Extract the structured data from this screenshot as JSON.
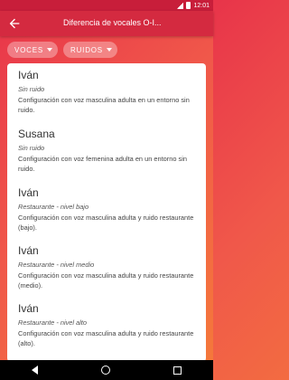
{
  "status_bar": {
    "time": "12:01"
  },
  "app_bar": {
    "title": "Diferencia de vocales O-I..."
  },
  "filters": [
    {
      "label": "VOCES"
    },
    {
      "label": "RUIDOS"
    }
  ],
  "items": [
    {
      "name": "Iván",
      "noise": "Sin ruido",
      "description": "Configuración con voz masculina adulta en un entorno sin ruido."
    },
    {
      "name": "Susana",
      "noise": "Sin ruido",
      "description": "Configuración con voz femenina adulta en un entorno sin ruido."
    },
    {
      "name": "Iván",
      "noise": "Restaurante - nivel bajo",
      "description": "Configuración con voz masculina adulta y ruido restaurante (bajo)."
    },
    {
      "name": "Iván",
      "noise": "Restaurante - nivel medio",
      "description": "Configuración con voz masculina adulta y ruido restaurante (medio)."
    },
    {
      "name": "Iván",
      "noise": "Restaurante - nivel alto",
      "description": "Configuración con voz masculina adulta y ruido restaurante (alto)."
    }
  ]
}
